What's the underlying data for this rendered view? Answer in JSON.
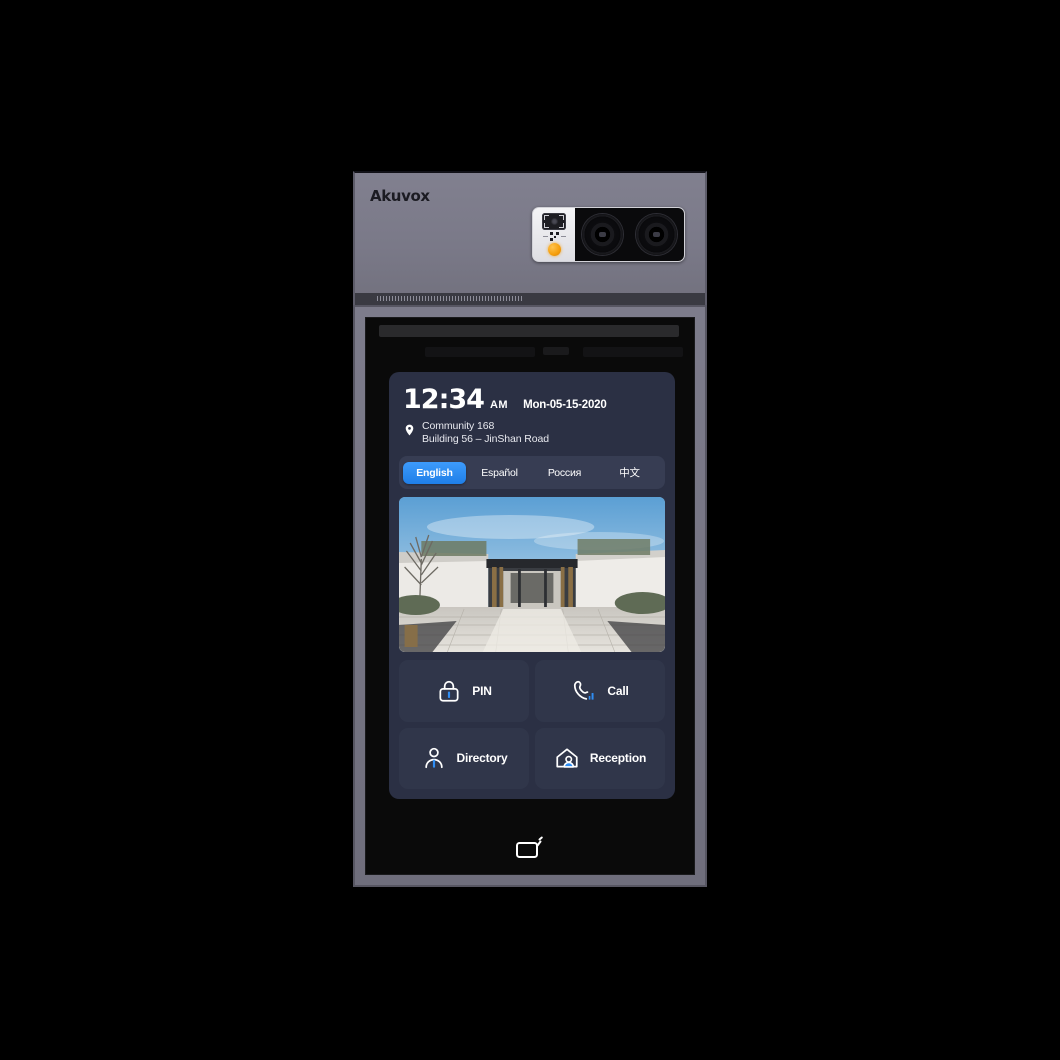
{
  "device": {
    "brand": "Akuvox",
    "camera_module": {
      "ir_sensor_icon": "ir-sensor-icon",
      "qr_reader_icon": "qr-code-icon",
      "status_led_icon": "status-led-indicator",
      "lens_left_icon": "camera-lens-icon",
      "lens_right_icon": "camera-lens-icon",
      "speaker_grille_icon": "speaker-grille"
    }
  },
  "screen": {
    "clock": {
      "time": "12:34",
      "meridiem": "AM",
      "date": "Mon-05-15-2020"
    },
    "location": {
      "pin_icon": "location-pin-icon",
      "line1": "Community 168",
      "line2": "Building 56 – JinShan Road"
    },
    "languages": [
      {
        "label": "English",
        "active": true
      },
      {
        "label": "Español",
        "active": false
      },
      {
        "label": "Россия",
        "active": false
      },
      {
        "label": "中文",
        "active": false
      }
    ],
    "photo": {
      "alt": "Community entrance gateway with paved walkway, white walls and hedges"
    },
    "tiles": [
      {
        "label": "PIN",
        "icon": "lock-icon"
      },
      {
        "label": "Call",
        "icon": "phone-call-icon"
      },
      {
        "label": "Directory",
        "icon": "person-icon"
      },
      {
        "label": "Reception",
        "icon": "house-person-icon"
      }
    ],
    "nav": {
      "icon": "card-tap-icon"
    }
  },
  "colors": {
    "bezel": "#7b7a8c",
    "panel": "#2b3044",
    "tile": "#30364a",
    "accent_blue": "#2f8ef4",
    "screen_black": "#0a0a0a"
  }
}
